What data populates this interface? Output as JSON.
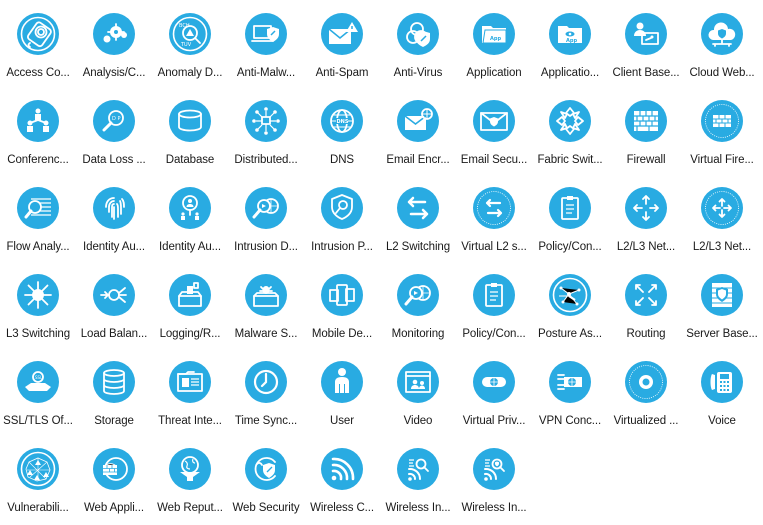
{
  "panel": {
    "accent_color": "#29abe2",
    "glyph_color": "#ffffff"
  },
  "shapes": [
    {
      "label": "Access Co...",
      "icon": "fingerprint-card-icon",
      "ring": true
    },
    {
      "label": "Analysis/C...",
      "icon": "gears-icon",
      "ring": false
    },
    {
      "label": "Anomaly D...",
      "icon": "magnifier-warning-icon",
      "ring": true
    },
    {
      "label": "Anti-Malw...",
      "icon": "laptop-shield-icon",
      "ring": false
    },
    {
      "label": "Anti-Spam",
      "icon": "envelope-warning-icon",
      "ring": false
    },
    {
      "label": "Anti-Virus",
      "icon": "biohazard-shield-icon",
      "ring": false
    },
    {
      "label": "Application",
      "icon": "app-folder-icon",
      "ring": false
    },
    {
      "label": "Applicatio...",
      "icon": "app-folder-eye-icon",
      "ring": false
    },
    {
      "label": "Client Base...",
      "icon": "user-key-screen-icon",
      "ring": false
    },
    {
      "label": "Cloud Web...",
      "icon": "cloud-shield-icon",
      "ring": false
    },
    {
      "label": "Conferenc...",
      "icon": "people-hierarchy-icon",
      "ring": false
    },
    {
      "label": "Data Loss ...",
      "icon": "magnifier-dp-icon",
      "ring": false
    },
    {
      "label": "Database",
      "icon": "database-cylinder-icon",
      "ring": false
    },
    {
      "label": "Distributed...",
      "icon": "distributed-nodes-icon",
      "ring": false
    },
    {
      "label": "DNS",
      "icon": "globe-dns-icon",
      "ring": false
    },
    {
      "label": "Email Encr...",
      "icon": "envelope-globe-icon",
      "ring": false
    },
    {
      "label": "Email Secu...",
      "icon": "envelope-shield-icon",
      "ring": false
    },
    {
      "label": "Fabric Swit...",
      "icon": "fabric-switch-icon",
      "ring": false
    },
    {
      "label": "Firewall",
      "icon": "brick-wall-icon",
      "ring": false
    },
    {
      "label": "Virtual Fire...",
      "icon": "virtual-brick-wall-icon",
      "ring": true
    },
    {
      "label": "Flow Analy...",
      "icon": "magnifier-flow-icon",
      "ring": false
    },
    {
      "label": "Identity Au...",
      "icon": "fingerprint-icon",
      "ring": false
    },
    {
      "label": "Identity Au...",
      "icon": "magnifier-users-icon",
      "ring": false
    },
    {
      "label": "Intrusion D...",
      "icon": "magnifier-globe-icon",
      "ring": false
    },
    {
      "label": "Intrusion P...",
      "icon": "shield-magnifier-icon",
      "ring": false
    },
    {
      "label": "L2 Switching",
      "icon": "switch-arrows-icon",
      "ring": false
    },
    {
      "label": "Virtual L2 s...",
      "icon": "virtual-switch-arrows-icon",
      "ring": true
    },
    {
      "label": "Policy/Con...",
      "icon": "clipboard-icon",
      "ring": false
    },
    {
      "label": "L2/L3 Net...",
      "icon": "router-cross-icon",
      "ring": false
    },
    {
      "label": "L2/L3 Net...",
      "icon": "virtual-router-cross-icon",
      "ring": true
    },
    {
      "label": "L3 Switching",
      "icon": "l3-switch-icon",
      "ring": false
    },
    {
      "label": "Load Balan...",
      "icon": "load-balancer-icon",
      "ring": false
    },
    {
      "label": "Logging/R...",
      "icon": "logging-box-icon",
      "ring": false
    },
    {
      "label": "Malware S...",
      "icon": "sandbox-bug-icon",
      "ring": false
    },
    {
      "label": "Mobile De...",
      "icon": "mobile-devices-icon",
      "ring": false
    },
    {
      "label": "Monitoring",
      "icon": "magnifier-globe-icon",
      "ring": false
    },
    {
      "label": "Policy/Con...",
      "icon": "clipboard-icon",
      "ring": false
    },
    {
      "label": "Posture As...",
      "icon": "network-key-icon",
      "ring": true
    },
    {
      "label": "Routing",
      "icon": "routing-arrows-icon",
      "ring": false
    },
    {
      "label": "Server Base...",
      "icon": "wall-shield-icon",
      "ring": false
    },
    {
      "label": "SSL/TLS Of...",
      "icon": "ssl-offload-icon",
      "ring": false
    },
    {
      "label": "Storage",
      "icon": "storage-stack-icon",
      "ring": false
    },
    {
      "label": "Threat Inte...",
      "icon": "id-card-folder-icon",
      "ring": false
    },
    {
      "label": "Time Sync...",
      "icon": "clock-icon",
      "ring": false
    },
    {
      "label": "User",
      "icon": "user-icon",
      "ring": false
    },
    {
      "label": "Video",
      "icon": "video-window-icon",
      "ring": false
    },
    {
      "label": "Virtual Priv...",
      "icon": "vpn-tunnel-icon",
      "ring": false
    },
    {
      "label": "VPN Conc...",
      "icon": "vpn-concentrator-icon",
      "ring": false
    },
    {
      "label": "Virtualized ...",
      "icon": "virtual-dot-icon",
      "ring": true
    },
    {
      "label": "Voice",
      "icon": "desk-phone-icon",
      "ring": false
    },
    {
      "label": "Vulnerabili...",
      "icon": "vulnerability-mesh-icon",
      "ring": true
    },
    {
      "label": "Web Appli...",
      "icon": "globe-wall-icon",
      "ring": false
    },
    {
      "label": "Web Reput...",
      "icon": "globe-funnel-icon",
      "ring": false
    },
    {
      "label": "Web Security",
      "icon": "globe-shield-icon",
      "ring": false
    },
    {
      "label": "Wireless C...",
      "icon": "wifi-icon",
      "ring": false
    },
    {
      "label": "Wireless In...",
      "icon": "wifi-magnifier-icon",
      "ring": false
    },
    {
      "label": "Wireless In...",
      "icon": "wifi-shield-magnifier-icon",
      "ring": false
    }
  ]
}
